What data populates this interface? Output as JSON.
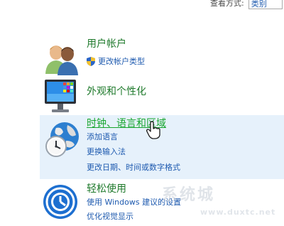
{
  "view_by": {
    "label": "查看方式:",
    "value": "类别"
  },
  "categories": [
    {
      "title": "用户帐户",
      "icon": "users-icon",
      "links": [
        "更改帐户类型"
      ]
    },
    {
      "title": "外观和个性化",
      "icon": "monitor-appearance-icon",
      "links": []
    },
    {
      "title": "时钟、语言和区域",
      "icon": "globe-clock-icon",
      "links": [
        "添加语言",
        "更换输入法",
        "更改日期、时间或数字格式"
      ]
    },
    {
      "title": "轻松使用",
      "icon": "ease-of-access-icon",
      "links": [
        "使用 Windows 建议的设置",
        "优化视觉显示"
      ]
    }
  ],
  "watermark": {
    "text": "系统城",
    "url": "www.duxtc.net"
  },
  "colors": {
    "category_title": "#1f7a2c",
    "hover_title": "#17a52e",
    "link": "#1e5aaf",
    "hover_bg": "#e6f1fb"
  }
}
